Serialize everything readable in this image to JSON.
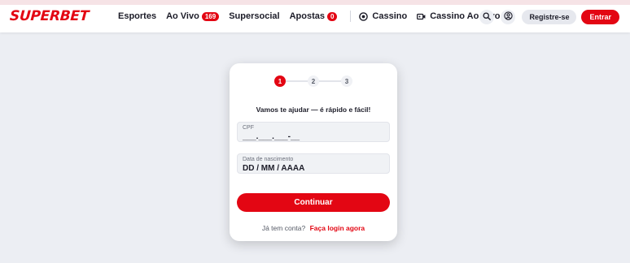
{
  "brand": {
    "logo_text": "SUPERBET",
    "accent": "#e30613"
  },
  "nav": {
    "items": [
      {
        "label": "Esportes"
      },
      {
        "label": "Ao Vivo",
        "badge": "169"
      },
      {
        "label": "Supersocial"
      },
      {
        "label": "Apostas",
        "badge": "0"
      }
    ],
    "casino": {
      "label": "Cassino",
      "icon": "casino-chip-icon"
    },
    "live_casino": {
      "label": "Cassino Ao Vivo",
      "icon": "video-camera-icon"
    }
  },
  "header_actions": {
    "search_icon": "search-icon",
    "account_icon": "user-circle-icon",
    "register_label": "Registre-se",
    "login_label": "Entrar"
  },
  "signup": {
    "steps": [
      "1",
      "2",
      "3"
    ],
    "active_step": 1,
    "heading": "Vamos te ajudar — é rápido e fácil!",
    "cpf": {
      "label": "CPF",
      "value": "___.___.___-__"
    },
    "birthdate": {
      "label": "Data de nascimento",
      "value": "DD / MM / AAAA"
    },
    "continue_label": "Continuar",
    "have_account": "Já tem conta?",
    "login_link": "Faça login agora"
  }
}
